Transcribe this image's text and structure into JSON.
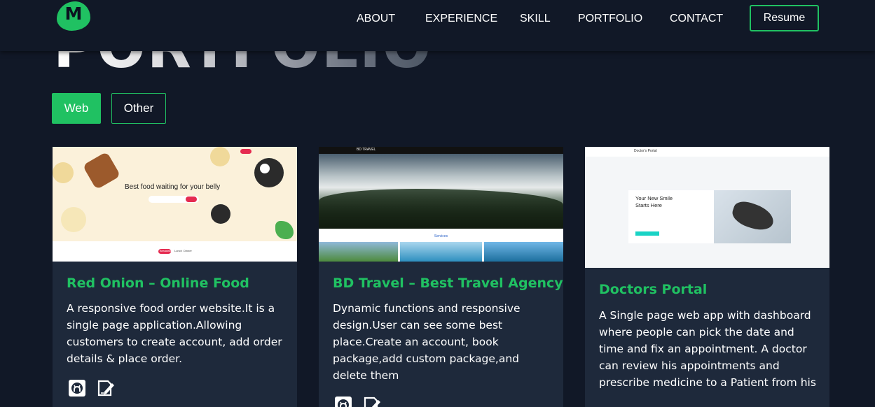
{
  "nav": {
    "logo_letter": "M",
    "links": [
      "ABOUT",
      "EXPERIENCE",
      "SKILL",
      "PORTFOLIO",
      "CONTACT"
    ],
    "resume_label": "Resume"
  },
  "section": {
    "title": "PORTFOLIO"
  },
  "filters": {
    "web": "Web",
    "other": "Other"
  },
  "colors": {
    "accent": "#20c162",
    "background": "#111827",
    "card": "#1e293b"
  },
  "projects": [
    {
      "title": "Red Onion – Online Food",
      "description": "A responsive food order website.It is a single page application.Allowing customers to create account, add order details & place order.",
      "icons": [
        "github-icon",
        "live-demo-icon"
      ],
      "thumbnail": {
        "headline": "Best food waiting for your belly",
        "tabs": [
          "Breakfast",
          "Lunch",
          "Dinner"
        ]
      }
    },
    {
      "title": "BD Travel – Best Travel Agency",
      "description": "Dynamic functions and responsive design.User can see some best place.Create an account, book package,add custom package,and delete them",
      "icons": [
        "github-icon",
        "live-demo-icon"
      ],
      "thumbnail": {
        "brand": "BD TRAVEL",
        "section": "Services"
      }
    },
    {
      "title": "Doctors Portal",
      "description": "A Single page web app with dashboard where people can pick the date and time and fix an appointment. A doctor can review his appointments and prescribe medicine to a Patient from his",
      "icons": [],
      "thumbnail": {
        "brand": "Doctor's Portal",
        "headline": "Your New Smile Starts Here"
      }
    }
  ]
}
